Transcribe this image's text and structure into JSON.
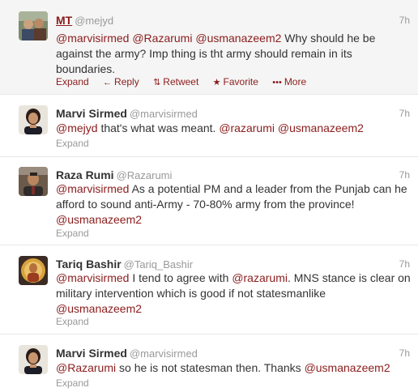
{
  "tweets": [
    {
      "fullname": "MT",
      "username": "@mejyd",
      "time": "7h",
      "parts": [
        "@marvisirmed",
        " ",
        "@Razarumi",
        " ",
        "@usmanazeem2",
        " Why should he be against the army? Imp thing is tht army should remain in its boundaries."
      ],
      "actions": {
        "expand": "Expand",
        "reply": "Reply",
        "retweet": "Retweet",
        "favorite": "Favorite",
        "more": "More"
      }
    },
    {
      "fullname": "Marvi Sirmed",
      "username": "@marvisirmed",
      "time": "7h",
      "parts": [
        "@mejyd",
        " that's what was meant. ",
        "@razarumi",
        " ",
        "@usmanazeem2"
      ],
      "expand": "Expand"
    },
    {
      "fullname": "Raza Rumi",
      "username": "@Razarumi",
      "time": "7h",
      "parts": [
        "@marvisirmed",
        " As a potential PM and a leader from the Punjab can he afford to sound anti-Army - 70-80% army from the province! ",
        "@usmanazeem2"
      ],
      "expand": "Expand"
    },
    {
      "fullname": "Tariq Bashir",
      "username": "@Tariq_Bashir",
      "time": "7h",
      "parts": [
        "@marvisirmed",
        " I tend to agree with ",
        "@razarumi",
        ". MNS stance is clear on military intervention which is good if not statesmanlike ",
        "@usmanazeem2"
      ],
      "expand": "Expand"
    },
    {
      "fullname": "Marvi Sirmed",
      "username": "@marvisirmed",
      "time": "7h",
      "parts": [
        "@Razarumi",
        " so he is not statesman then. Thanks ",
        "@usmanazeem2"
      ],
      "expand": "Expand"
    }
  ],
  "colors": {
    "link": "#8b1c1c",
    "muted": "#999999",
    "highlight_bg": "#f5f5f5"
  },
  "icons": {
    "reply": "reply-arrow-icon",
    "retweet": "retweet-icon",
    "favorite": "star-icon",
    "more": "more-dots-icon"
  }
}
